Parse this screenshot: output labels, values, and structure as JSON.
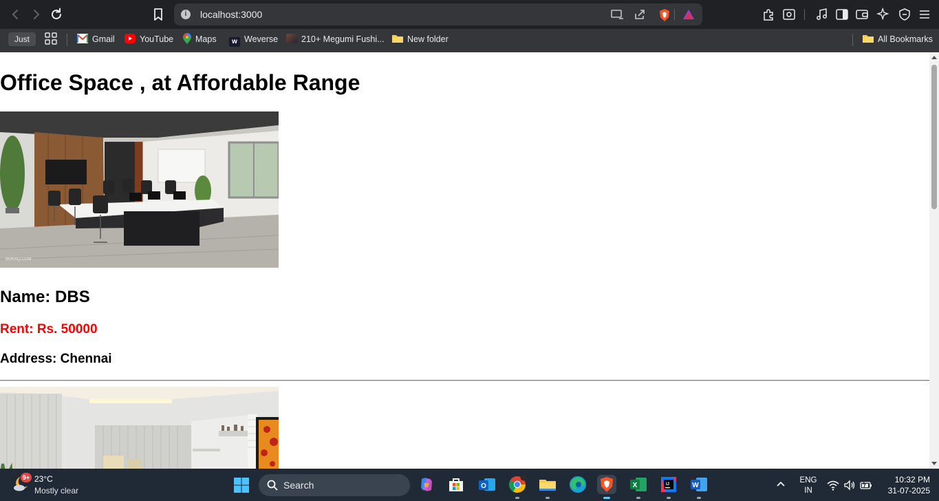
{
  "browser": {
    "url": "localhost:3000",
    "bookmarks_bar": {
      "just_label": "Just",
      "items": [
        {
          "label": "Gmail",
          "icon": "gmail-icon"
        },
        {
          "label": "YouTube",
          "icon": "youtube-icon"
        },
        {
          "label": "Maps",
          "icon": "maps-icon"
        },
        {
          "label": "Weverse",
          "icon": "weverse-icon"
        },
        {
          "label": "210+ Megumi Fushi...",
          "icon": "site-favicon"
        },
        {
          "label": "New folder",
          "icon": "folder-icon"
        }
      ],
      "all_bookmarks_label": "All Bookmarks"
    },
    "accent_colors": {
      "brave": "#fb542b"
    }
  },
  "page": {
    "heading": "Office Space , at Affordable Range",
    "offices": [
      {
        "name": "Name: DBS",
        "rent": "Rent: Rs. 50000",
        "address": "Address: Chennai",
        "rent_color": "#ff0000"
      }
    ]
  },
  "taskbar": {
    "weather": {
      "temp": "23°C",
      "condition": "Mostly clear",
      "badge": "9+"
    },
    "search_label": "Search",
    "language": {
      "line1": "ENG",
      "line2": "IN"
    },
    "clock": {
      "time": "10:32 PM",
      "date": "31-07-2025"
    }
  }
}
